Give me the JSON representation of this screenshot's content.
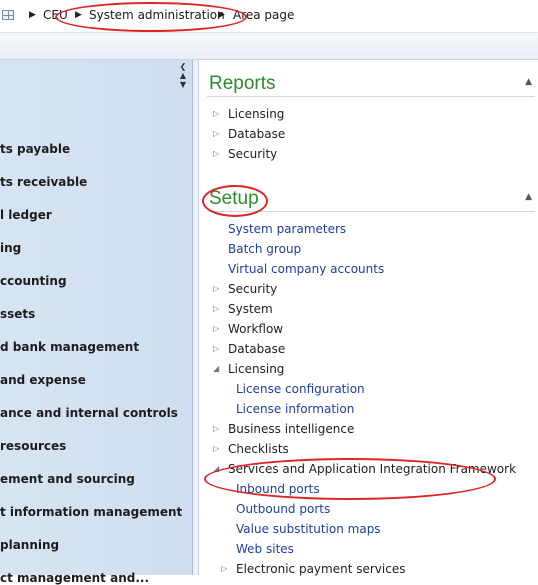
{
  "breadcrumb": [
    "CEU",
    "System administration",
    "Area page"
  ],
  "nav_items": [
    "ts payable",
    "ts receivable",
    "l ledger",
    "ing",
    "ccounting",
    "ssets",
    "d bank management",
    "and expense",
    "ance and internal controls",
    " resources",
    "ement and sourcing",
    "t information management",
    "planning",
    "ct management and..."
  ],
  "sections": {
    "reports": {
      "title": "Reports",
      "items": [
        {
          "label": "Licensing",
          "type": "group",
          "expanded": false
        },
        {
          "label": "Database",
          "type": "group",
          "expanded": false
        },
        {
          "label": "Security",
          "type": "group",
          "expanded": false
        }
      ]
    },
    "setup": {
      "title": "Setup",
      "items": [
        {
          "label": "System parameters",
          "type": "link"
        },
        {
          "label": "Batch group",
          "type": "link"
        },
        {
          "label": "Virtual company accounts",
          "type": "link"
        },
        {
          "label": "Security",
          "type": "group",
          "expanded": false
        },
        {
          "label": "System",
          "type": "group",
          "expanded": false
        },
        {
          "label": "Workflow",
          "type": "group",
          "expanded": false
        },
        {
          "label": "Database",
          "type": "group",
          "expanded": false
        },
        {
          "label": "Licensing",
          "type": "group",
          "expanded": true
        },
        {
          "label": "License configuration",
          "type": "sublink"
        },
        {
          "label": "License information",
          "type": "sublink"
        },
        {
          "label": "Business intelligence",
          "type": "group",
          "expanded": false
        },
        {
          "label": "Checklists",
          "type": "group",
          "expanded": false
        },
        {
          "label": "Services and Application Integration Framework",
          "type": "group",
          "expanded": true
        },
        {
          "label": "Inbound ports",
          "type": "sublink"
        },
        {
          "label": "Outbound ports",
          "type": "sublink"
        },
        {
          "label": "Value substitution maps",
          "type": "sublink"
        },
        {
          "label": "Web sites",
          "type": "sublink"
        },
        {
          "label": "Electronic payment services",
          "type": "subgroup",
          "expanded": false
        }
      ]
    }
  },
  "colors": {
    "section_title": "#2e8b2e",
    "link": "#1f3f9a",
    "annotation": "#e02525",
    "nav_bg": "#d7e4f3"
  }
}
